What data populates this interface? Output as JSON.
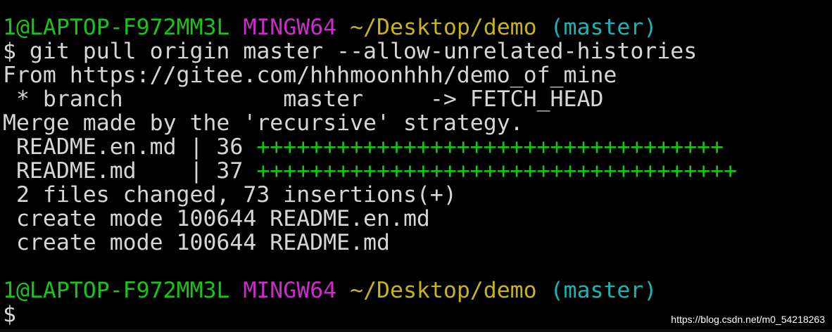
{
  "terminal": {
    "prompt1": {
      "user_host": "1@LAPTOP-F972MM3L",
      "env": "MINGW64",
      "path": "~/Desktop/demo",
      "branch": "(master)"
    },
    "command": "$ git pull origin master --allow-unrelated-histories",
    "output": {
      "from_line": "From https://gitee.com/hhhmoonhhh/demo_of_mine",
      "branch_line": " * branch            master     -> FETCH_HEAD",
      "merge_line": "Merge made by the 'recursive' strategy.",
      "file1": {
        "label": " README.en.md | 36 ",
        "plus": "+++++++++++++++++++++++++++++++++++"
      },
      "file2": {
        "label": " README.md    | 37 ",
        "plus": "++++++++++++++++++++++++++++++++++++"
      },
      "summary": " 2 files changed, 73 insertions(+)",
      "create1": " create mode 100644 README.en.md",
      "create2": " create mode 100644 README.md"
    },
    "prompt2": {
      "user_host": "1@LAPTOP-F972MM3L",
      "env": "MINGW64",
      "path": "~/Desktop/demo",
      "branch": "(master)"
    },
    "cursor_prompt": "$"
  },
  "watermark": "https://blog.csdn.net/m0_54218263",
  "colors": {
    "background": "#000000",
    "text": "#d6d6d6",
    "user_host": "#18c418",
    "env": "#cc2ccc",
    "path": "#c7b41d",
    "branch": "#1ab4b4"
  }
}
